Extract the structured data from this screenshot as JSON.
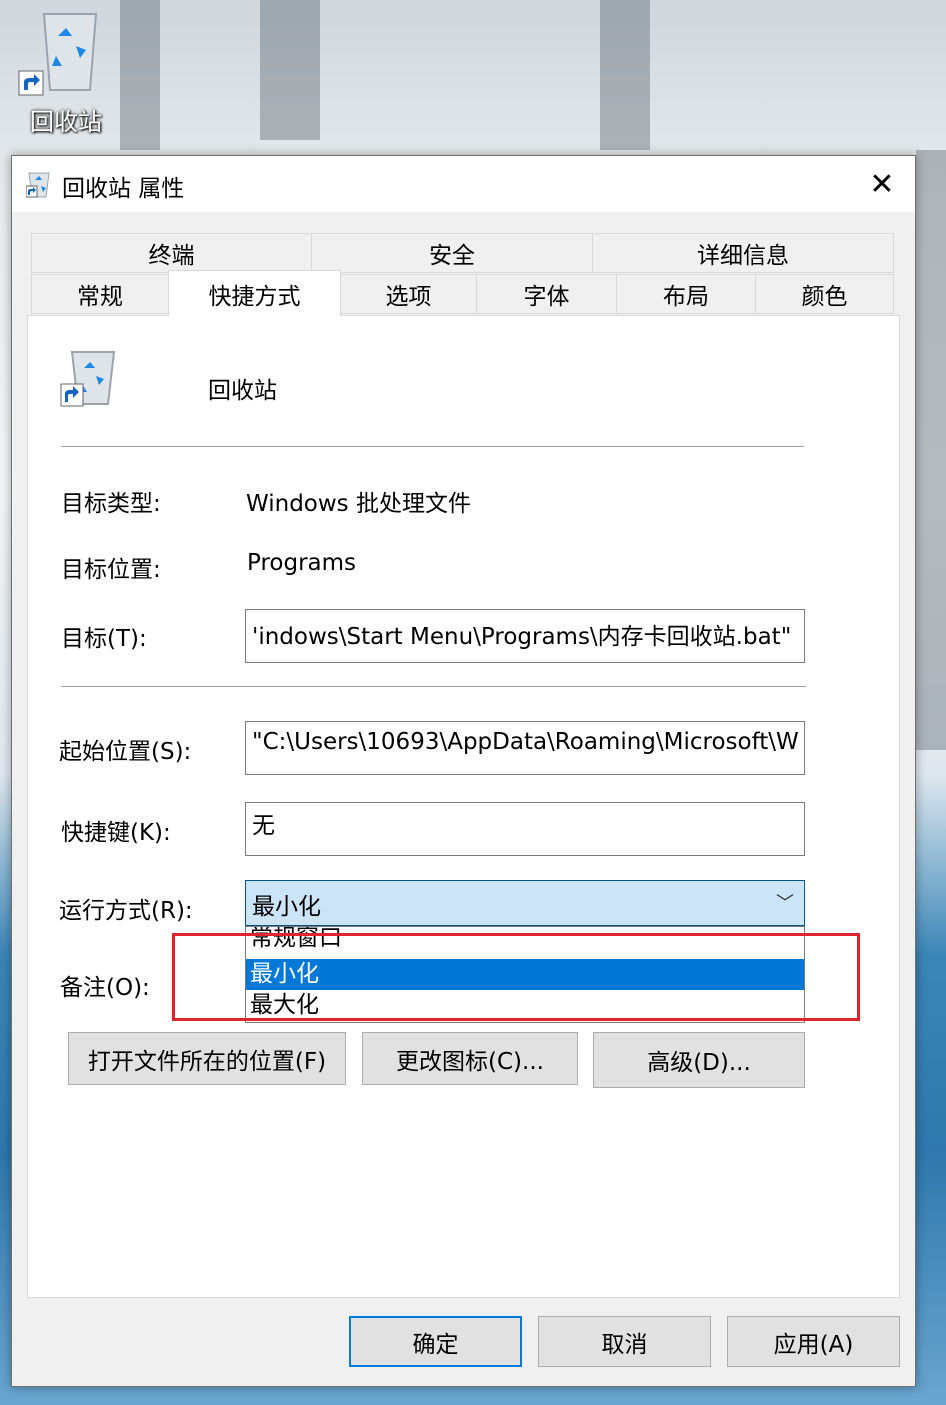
{
  "desktop": {
    "icon_label": "回收站"
  },
  "window": {
    "title": "回收站 属性",
    "close_glyph": "✕",
    "tabs_row1": [
      "终端",
      "安全",
      "详细信息"
    ],
    "tabs_row2": [
      "常规",
      "快捷方式",
      "选项",
      "字体",
      "布局",
      "颜色"
    ],
    "active_tab": "快捷方式"
  },
  "shortcut": {
    "name": "回收站",
    "target_type_label": "目标类型:",
    "target_type_value": "Windows 批处理文件",
    "target_location_label": "目标位置:",
    "target_location_value": "Programs",
    "target_label": "目标(T):",
    "target_value": "'indows\\Start Menu\\Programs\\内存卡回收站.bat\"",
    "start_in_label": "起始位置(S):",
    "start_in_value": "\"C:\\Users\\10693\\AppData\\Roaming\\Microsoft\\W",
    "hotkey_label": "快捷键(K):",
    "hotkey_value": "无",
    "run_label": "运行方式(R):",
    "run_value": "最小化",
    "run_options": [
      "常规窗口",
      "最小化",
      "最大化"
    ],
    "run_selected_index": 1,
    "comment_label": "备注(O):",
    "open_location_button": "打开文件所在的位置(F)",
    "change_icon_button": "更改图标(C)...",
    "advanced_button": "高级(D)..."
  },
  "footer": {
    "ok": "确定",
    "cancel": "取消",
    "apply": "应用(A)"
  },
  "colors": {
    "accent": "#0078d7",
    "highlight_box": "#e0242f",
    "combo_bg": "#cce4f7"
  },
  "icons": [
    "recycle-bin-icon",
    "shortcut-arrow-icon",
    "close-icon",
    "chevron-down-icon"
  ]
}
